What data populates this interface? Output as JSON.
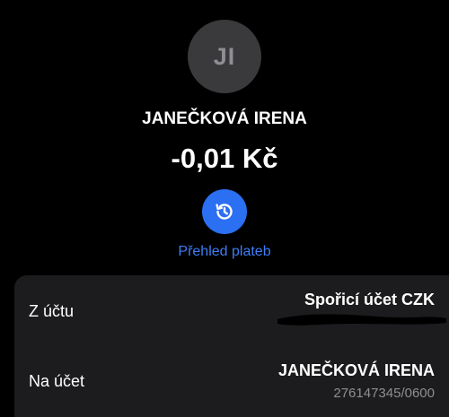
{
  "recipient": {
    "initials": "JI",
    "name": "JANEČKOVÁ IRENA"
  },
  "payment": {
    "amount": "-0,01 Kč"
  },
  "actions": {
    "history_label": "Přehled plateb",
    "history_icon": "history-clock-icon"
  },
  "details": {
    "from_label": "Z účtu",
    "from_value": "Spořicí účet CZK",
    "to_label": "Na účet",
    "to_name": "JANEČKOVÁ IRENA",
    "to_account": "276147345/0600"
  },
  "colors": {
    "background": "#000000",
    "accent": "#2b6ff2",
    "link": "#3c7ef5",
    "card": "#1c1c1e",
    "muted": "#8e8e93"
  }
}
